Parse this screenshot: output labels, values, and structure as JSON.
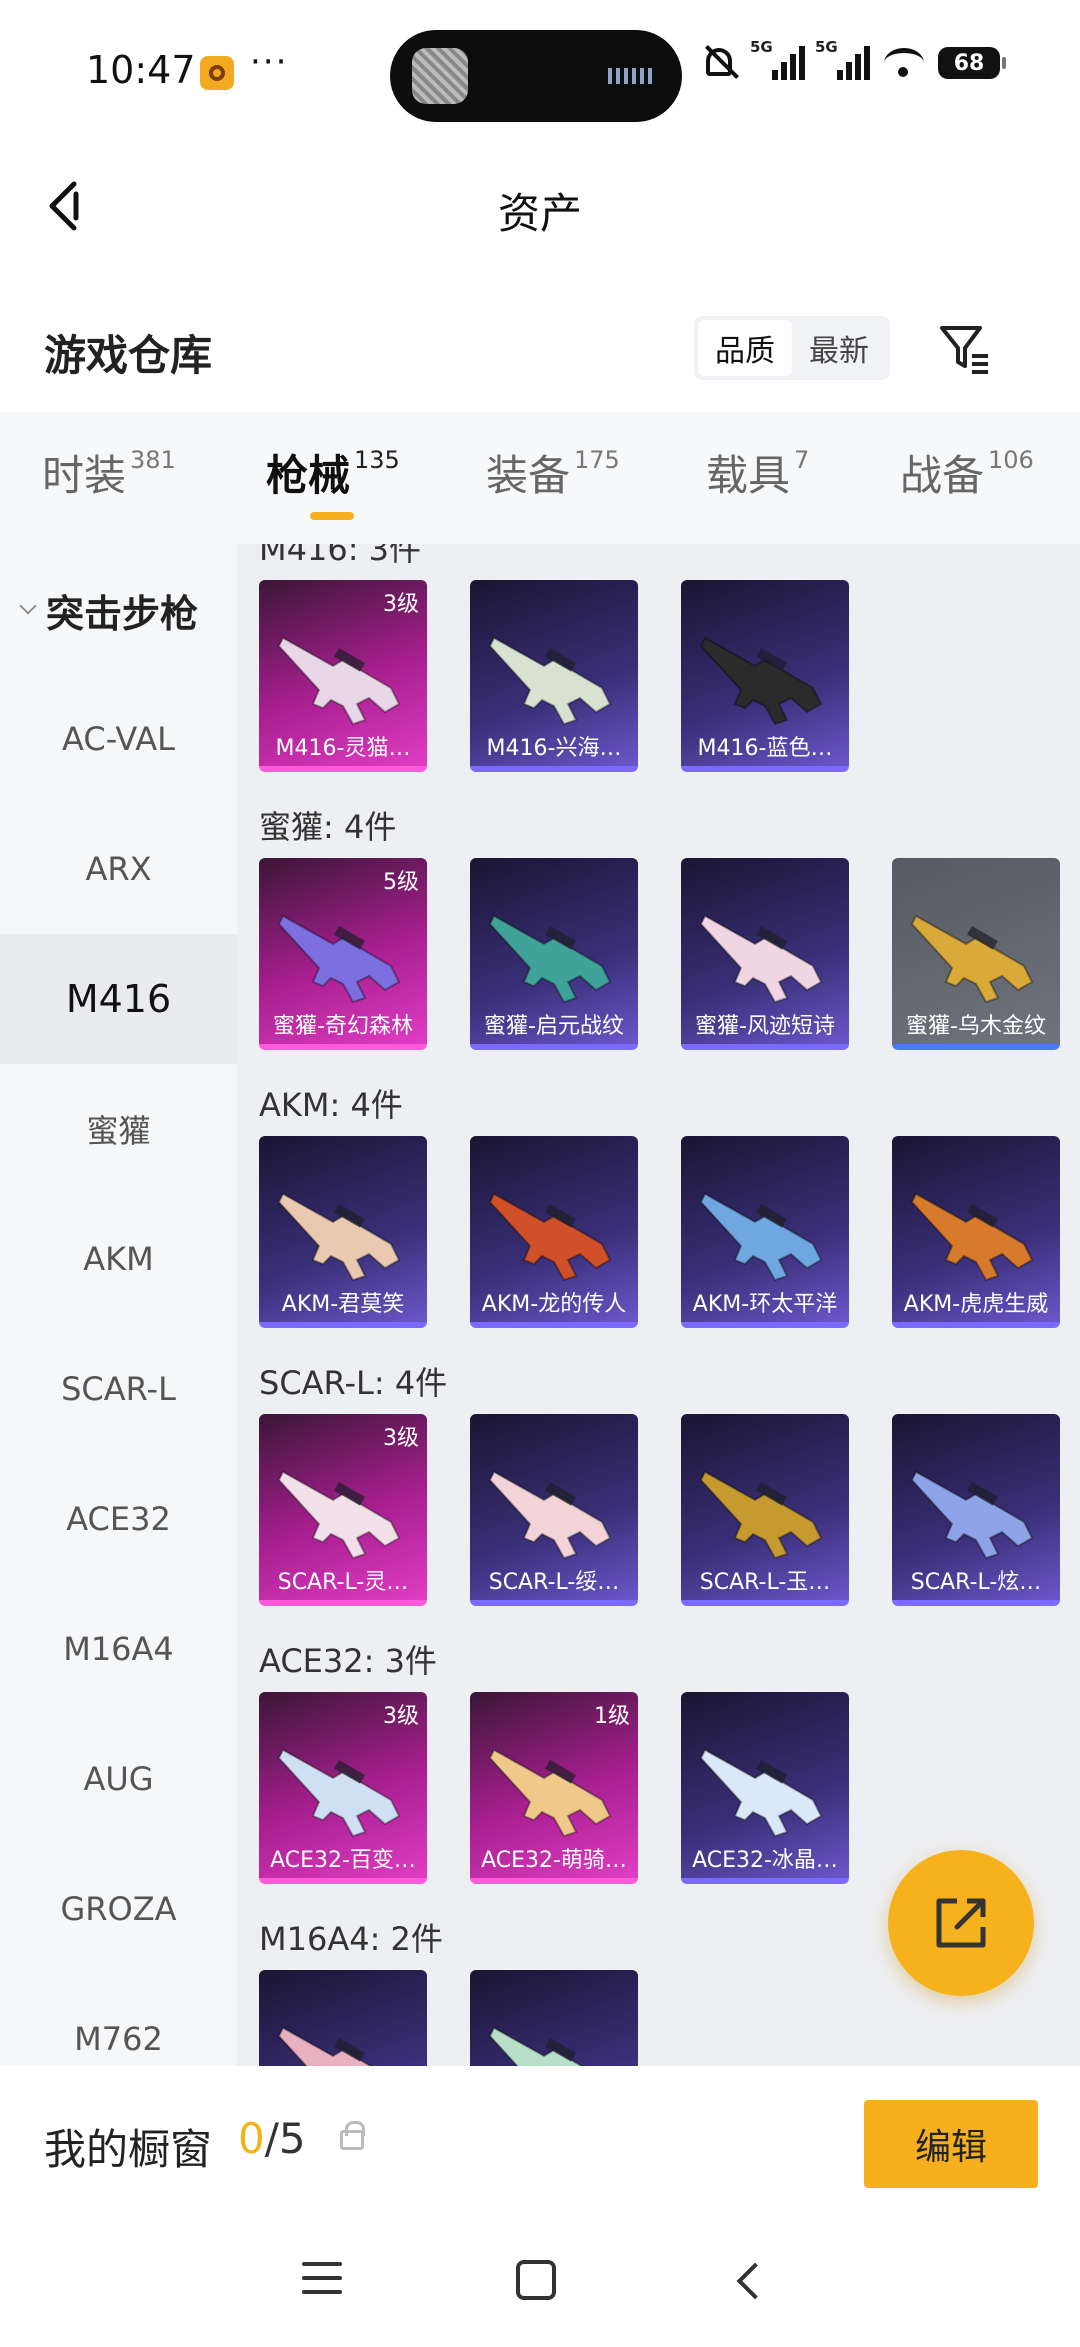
{
  "status_bar": {
    "time": "10:47",
    "dots": "···",
    "battery": "68",
    "net1": "5G",
    "net2": "5G"
  },
  "nav": {
    "title": "资产"
  },
  "warehouse": {
    "title": "游戏仓库",
    "sort_options": [
      "品质",
      "最新"
    ],
    "sort_active": "品质"
  },
  "tabs": [
    {
      "label": "时装",
      "count": "381"
    },
    {
      "label": "枪械",
      "count": "135"
    },
    {
      "label": "装备",
      "count": "175"
    },
    {
      "label": "载具",
      "count": "7"
    },
    {
      "label": "战备",
      "count": "106"
    }
  ],
  "sidebar": {
    "group": "突击步枪",
    "items": [
      "AC-VAL",
      "ARX",
      "M416",
      "蜜獾",
      "AKM",
      "SCAR-L",
      "ACE32",
      "M16A4",
      "AUG",
      "GROZA",
      "M762"
    ],
    "active": "M416"
  },
  "groups": [
    {
      "label": "M416: 3件",
      "items": [
        {
          "name": "M416-灵猫…",
          "level": "3级",
          "rarity": "gold",
          "gun": "#e9d6e6"
        },
        {
          "name": "M416-兴海…",
          "level": "",
          "rarity": "purple",
          "gun": "#d8e2d0"
        },
        {
          "name": "M416-蓝色…",
          "level": "",
          "rarity": "purple",
          "gun": "#2b2b2b"
        }
      ]
    },
    {
      "label": "蜜獾: 4件",
      "items": [
        {
          "name": "蜜獾-奇幻森林",
          "level": "5级",
          "rarity": "gold",
          "gun": "#7d6fe0"
        },
        {
          "name": "蜜獾-启元战纹",
          "level": "",
          "rarity": "purple",
          "gun": "#3fa39a"
        },
        {
          "name": "蜜獾-风迹短诗",
          "level": "",
          "rarity": "purple",
          "gun": "#f0d6e2"
        },
        {
          "name": "蜜獾-乌木金纹",
          "level": "",
          "rarity": "gray",
          "gun": "#d9a93a"
        }
      ]
    },
    {
      "label": "AKM: 4件",
      "items": [
        {
          "name": "AKM-君莫笑",
          "level": "",
          "rarity": "purple",
          "gun": "#e9c9b0"
        },
        {
          "name": "AKM-龙的传人",
          "level": "",
          "rarity": "purple",
          "gun": "#d0502a"
        },
        {
          "name": "AKM-环太平洋",
          "level": "",
          "rarity": "purple",
          "gun": "#6fa8e0"
        },
        {
          "name": "AKM-虎虎生威",
          "level": "",
          "rarity": "purple",
          "gun": "#d77a2c"
        }
      ]
    },
    {
      "label": "SCAR-L: 4件",
      "items": [
        {
          "name": "SCAR-L-灵…",
          "level": "3级",
          "rarity": "gold",
          "gun": "#f2e0ea"
        },
        {
          "name": "SCAR-L-绥…",
          "level": "",
          "rarity": "purple",
          "gun": "#f1d3d8"
        },
        {
          "name": "SCAR-L-玉…",
          "level": "",
          "rarity": "purple",
          "gun": "#c79a30"
        },
        {
          "name": "SCAR-L-炫…",
          "level": "",
          "rarity": "purple",
          "gun": "#8fa4e8"
        }
      ]
    },
    {
      "label": "ACE32: 3件",
      "items": [
        {
          "name": "ACE32-百变…",
          "level": "3级",
          "rarity": "gold",
          "gun": "#cfe0f5"
        },
        {
          "name": "ACE32-萌骑…",
          "level": "1级",
          "rarity": "gold",
          "gun": "#f0c98a"
        },
        {
          "name": "ACE32-冰晶…",
          "level": "",
          "rarity": "purple",
          "gun": "#dbe8f7"
        }
      ]
    },
    {
      "label": "M16A4: 2件",
      "items": [
        {
          "name": "",
          "level": "",
          "rarity": "purple",
          "gun": "#e8b0c0"
        },
        {
          "name": "",
          "level": "",
          "rarity": "purple",
          "gun": "#b8e0c8"
        }
      ]
    }
  ],
  "showcase": {
    "title": "我的橱窗",
    "count_used": "0",
    "count_sep": "/5",
    "edit_label": "编辑"
  }
}
